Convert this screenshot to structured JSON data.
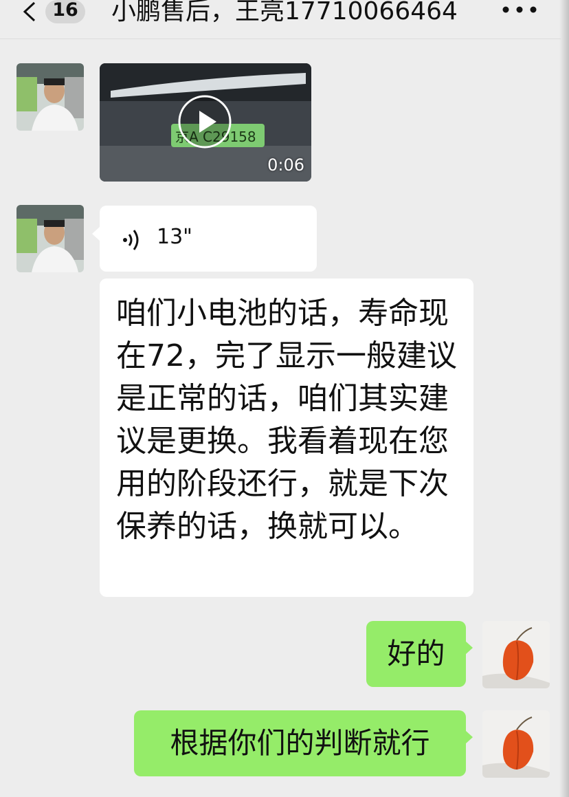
{
  "header": {
    "back_icon": "chevron-left-icon",
    "unread_count": "16",
    "title": "小鹏售后，王亮17710066464",
    "more_icon": "more-dots-icon"
  },
  "messages": [
    {
      "sender": "contact",
      "type": "video",
      "duration": "0:06"
    },
    {
      "sender": "contact",
      "type": "voice",
      "duration": "13\""
    },
    {
      "sender": "contact",
      "type": "text",
      "text": "咱们小电池的话，寿命现在72，完了显示一般建议是正常的话，咱们其实建议是更换。我看着现在您用的阶段还行，就是下次保养的话，换就可以。"
    },
    {
      "sender": "me",
      "type": "text",
      "text": "好的"
    },
    {
      "sender": "me",
      "type": "text",
      "text": "根据你们的判断就行"
    }
  ],
  "colors": {
    "background": "#ededed",
    "self_bubble": "#95ec69",
    "other_bubble": "#ffffff"
  }
}
